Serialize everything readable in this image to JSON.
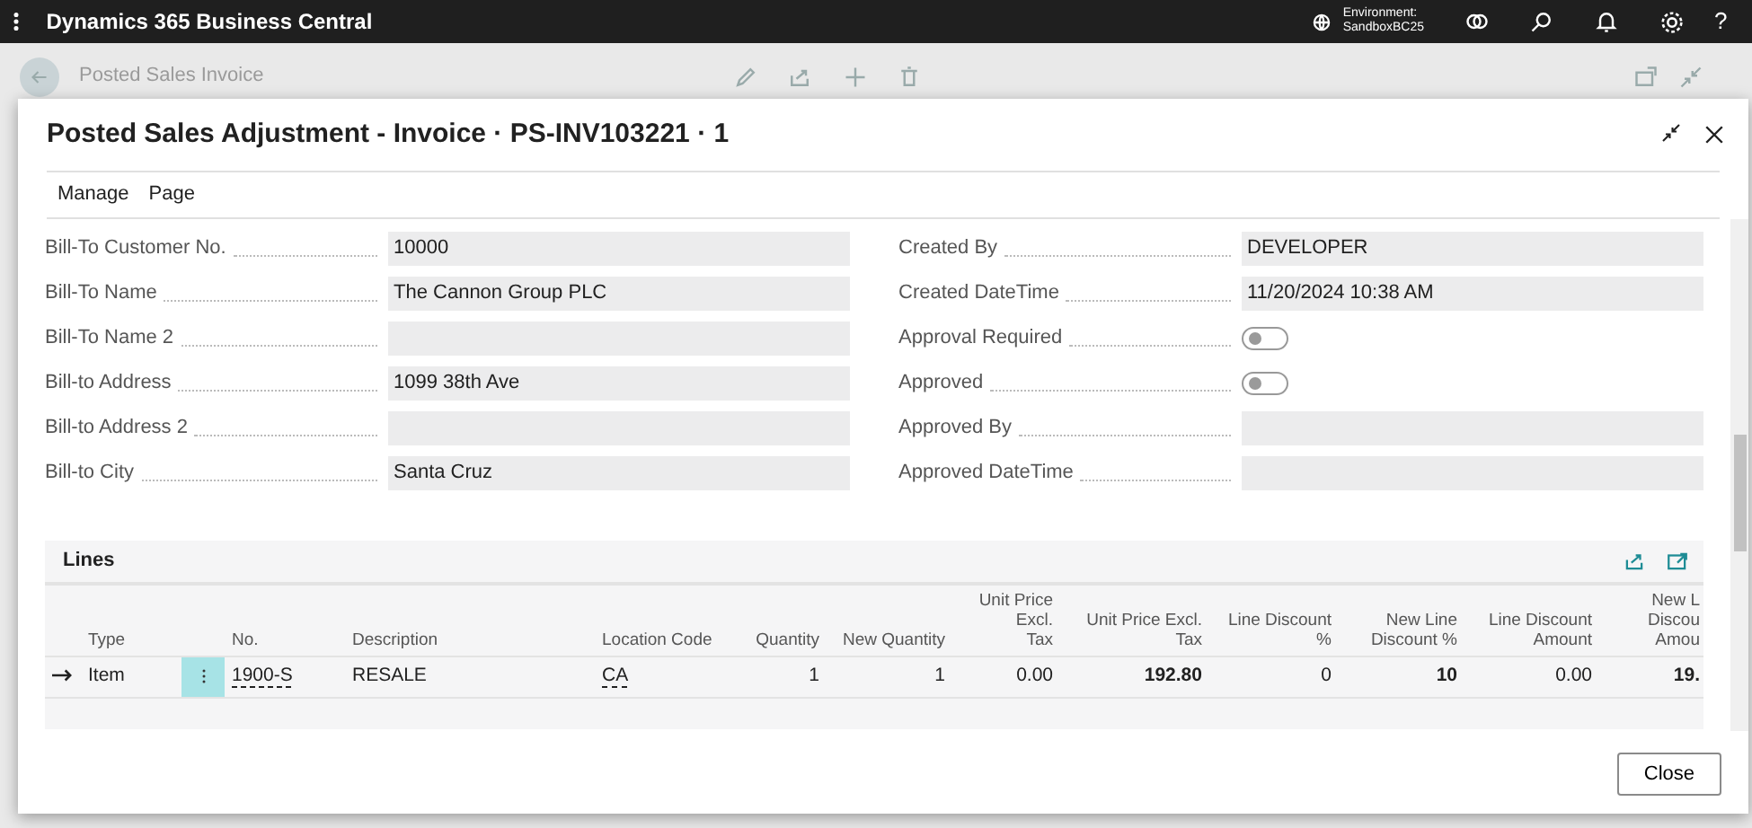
{
  "top_bar": {
    "app_title": "Dynamics 365 Business Central",
    "environment_label": "Environment:",
    "environment_name": "SandboxBC25",
    "help": "?"
  },
  "background_page": {
    "title": "Posted Sales Invoice"
  },
  "dialog": {
    "title": "Posted Sales Adjustment - Invoice · PS-INV103221 · 1",
    "menu": [
      "Manage",
      "Page"
    ],
    "left_fields": [
      {
        "label": "Bill-To Customer No.",
        "value": "10000"
      },
      {
        "label": "Bill-To Name",
        "value": "The Cannon Group PLC"
      },
      {
        "label": "Bill-To Name 2"
      },
      {
        "label": "Bill-to Address",
        "value": "1099 38th Ave"
      },
      {
        "label": "Bill-to Address 2"
      },
      {
        "label": "Bill-to City",
        "value": "Santa Cruz"
      }
    ],
    "right_fields": [
      {
        "label": "Created By",
        "kind": "text",
        "value": "DEVELOPER"
      },
      {
        "label": "Created DateTime",
        "kind": "text",
        "value": "11/20/2024 10:38 AM"
      },
      {
        "label": "Approval Required",
        "kind": "toggle",
        "on": false
      },
      {
        "label": "Approved",
        "kind": "toggle",
        "on": false
      },
      {
        "label": "Approved By",
        "kind": "text"
      },
      {
        "label": "Approved DateTime",
        "kind": "text"
      }
    ],
    "lines": {
      "title": "Lines",
      "columns": [
        {
          "header": "Type",
          "kind": "text",
          "bold": false
        },
        {
          "header": "No.",
          "kind": "link",
          "bold": false
        },
        {
          "header": "Description",
          "kind": "text",
          "bold": false
        },
        {
          "header": "Location Code",
          "kind": "link",
          "bold": false
        },
        {
          "header": "Quantity",
          "kind": "number",
          "bold": false
        },
        {
          "header": "New Quantity",
          "kind": "number",
          "bold": false
        },
        {
          "header": "Unit Price Excl.\nTax",
          "kind": "number",
          "bold": false
        },
        {
          "header": "Unit Price Excl.\nTax",
          "kind": "number",
          "bold": true
        },
        {
          "header": "Line Discount %",
          "kind": "number",
          "bold": false
        },
        {
          "header": "New Line\nDiscount %",
          "kind": "number",
          "bold": true
        },
        {
          "header": "Line Discount\nAmount",
          "kind": "number",
          "bold": false
        },
        {
          "header": "New L\nDiscou\nAmou",
          "kind": "number",
          "bold": true
        }
      ],
      "rows": [
        {
          "current": true,
          "cells": [
            "Item",
            "1900-S",
            "RESALE",
            "CA",
            "1",
            "1",
            "0.00",
            "192.80",
            "0",
            "10",
            "0.00",
            "19."
          ]
        }
      ]
    },
    "close_button": "Close"
  }
}
